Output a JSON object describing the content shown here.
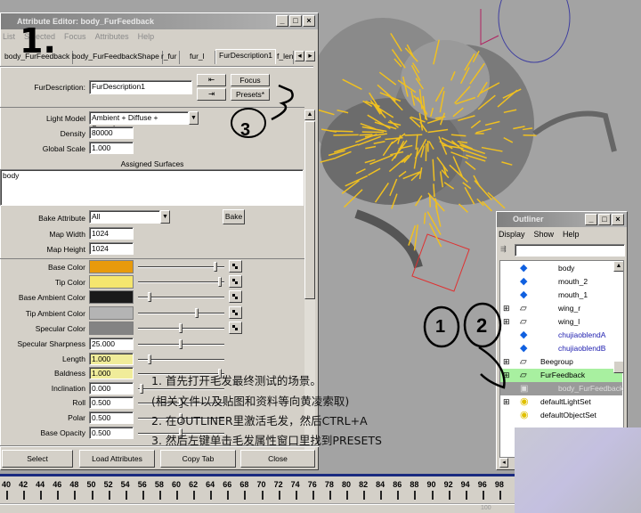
{
  "attribute_editor": {
    "title": "Attribute Editor: body_FurFeedback",
    "menu": [
      "List",
      "Selected",
      "Focus",
      "Attributes",
      "Help"
    ],
    "tabs": [
      "body_FurFeedback",
      "body_FurFeedbackShape",
      "r_fur",
      "fur_l",
      "FurDescription1",
      "f_leng"
    ],
    "active_tab": "FurDescription1",
    "node_label": "FurDescription:",
    "node_value": "FurDescription1",
    "focus_label": "Focus",
    "presets_label": "Presets*",
    "light_model_label": "Light Model",
    "light_model_value": "Ambient + Diffuse + Specular",
    "density_label": "Density",
    "density_value": "80000",
    "global_scale_label": "Global Scale",
    "global_scale_value": "1.000",
    "assigned_surfaces_label": "Assigned Surfaces",
    "assigned_surfaces": "body",
    "bake_attribute_label": "Bake Attribute",
    "bake_attribute_value": "All",
    "bake_label": "Bake",
    "map_width_label": "Map Width",
    "map_width_value": "1024",
    "map_height_label": "Map Height",
    "map_height_value": "1024",
    "colors": [
      {
        "label": "Base Color",
        "color": "#e89a0c",
        "slider": 0.92
      },
      {
        "label": "Tip Color",
        "color": "#f5e66e",
        "slider": 0.98
      },
      {
        "label": "Base Ambient Color",
        "color": "#1a1a1a",
        "slider": 0.12
      },
      {
        "label": "Tip Ambient Color",
        "color": "#b4b4b4",
        "slider": 0.7
      },
      {
        "label": "Specular Color",
        "color": "#838383",
        "slider": 0.5
      }
    ],
    "numeric": [
      {
        "label": "Specular Sharpness",
        "value": "25.000",
        "slider": 0.5,
        "highlight": false
      },
      {
        "label": "Length",
        "value": "1.000",
        "slider": 0.12,
        "highlight": true
      },
      {
        "label": "Baldness",
        "value": "1.000",
        "slider": 0.98,
        "highlight": true
      },
      {
        "label": "Inclination",
        "value": "0.000",
        "slider": 0.02,
        "highlight": false
      },
      {
        "label": "Roll",
        "value": "0.500",
        "slider": 0.5,
        "highlight": false
      },
      {
        "label": "Polar",
        "value": "0.500",
        "slider": 0.5,
        "highlight": false
      },
      {
        "label": "Base Opacity",
        "value": "0.500",
        "slider": 0.5,
        "highlight": false
      }
    ],
    "buttons": [
      "Select",
      "Load Attributes",
      "Copy Tab",
      "Close"
    ]
  },
  "outliner": {
    "title": "Outliner",
    "menu": [
      "Display",
      "Show",
      "Help"
    ],
    "items": [
      {
        "name": "body",
        "icon": "mesh",
        "expand": false,
        "blue": false
      },
      {
        "name": "mouth_2",
        "icon": "mesh",
        "expand": false,
        "blue": false
      },
      {
        "name": "mouth_1",
        "icon": "mesh",
        "expand": false,
        "blue": false
      },
      {
        "name": "wing_r",
        "icon": "transform",
        "expand": true,
        "blue": false
      },
      {
        "name": "wing_l",
        "icon": "transform",
        "expand": true,
        "blue": false
      },
      {
        "name": "chujiaoblendA",
        "icon": "mesh",
        "expand": false,
        "blue": true
      },
      {
        "name": "chujiaoblendB",
        "icon": "mesh",
        "expand": false,
        "blue": true
      },
      {
        "name": "Beegroup",
        "icon": "transform",
        "expand": true,
        "blue": false
      },
      {
        "name": "FurFeedback",
        "icon": "transform",
        "expand": true,
        "blue": false
      },
      {
        "name": "body_FurFeedback",
        "icon": "fur",
        "expand": false,
        "blue": false
      },
      {
        "name": "defaultLightSet",
        "icon": "set",
        "expand": true,
        "blue": false
      },
      {
        "name": "defaultObjectSet",
        "icon": "set",
        "expand": false,
        "blue": false
      }
    ]
  },
  "annotations": {
    "step1": "1.",
    "circle1": "1",
    "circle2": "2",
    "circle3": "3",
    "notes": [
      "1. 首先打开毛发最终测试的场景。",
      "(相关文件以及贴图和资料等向黄凌索取)",
      "2. 在OUTLINER里激活毛发，然后CTRL+A",
      "3. 然后左键单击毛发属性窗口里找到PRESETS"
    ]
  },
  "timeline": {
    "labels": [
      "40",
      "42",
      "44",
      "46",
      "48",
      "50",
      "52",
      "54",
      "56",
      "58",
      "60",
      "62",
      "64",
      "66",
      "68",
      "70",
      "72",
      "74",
      "76",
      "78",
      "80",
      "82",
      "84",
      "86",
      "88",
      "90",
      "92",
      "94",
      "96",
      "98"
    ],
    "end_field": "100"
  }
}
